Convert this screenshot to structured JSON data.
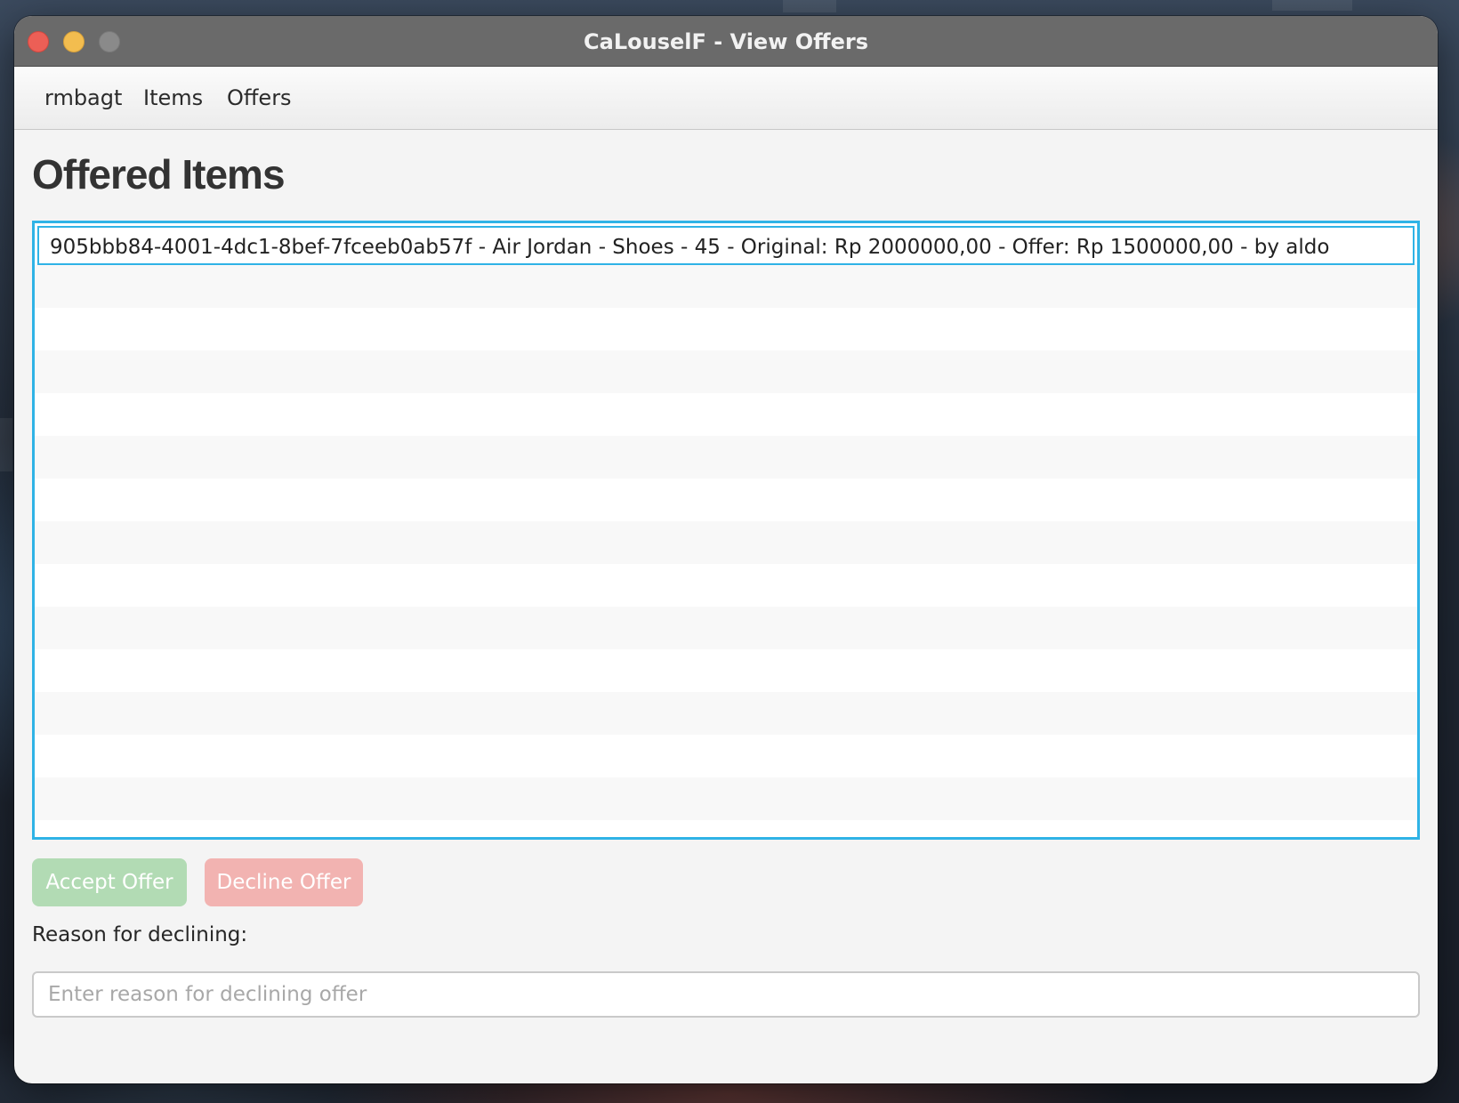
{
  "window": {
    "title": "CaLouselF - View Offers"
  },
  "menu": {
    "items": [
      "rmbagt",
      "Items",
      "Offers"
    ]
  },
  "main": {
    "heading": "Offered Items",
    "offers": [
      "905bbb84-4001-4dc1-8bef-7fceeb0ab57f - Air Jordan - Shoes - 45 - Original: Rp 2000000,00 - Offer: Rp 1500000,00 - by aldo"
    ],
    "accept_label": "Accept Offer",
    "decline_label": "Decline Offer",
    "reason_label": "Reason for declining:",
    "reason_placeholder": "Enter reason for declining offer",
    "reason_value": ""
  },
  "colors": {
    "accent": "#2fb3e6",
    "accept_button": "#b2dbb4",
    "decline_button": "#f2b3b1",
    "titlebar": "#6a6a6a"
  }
}
